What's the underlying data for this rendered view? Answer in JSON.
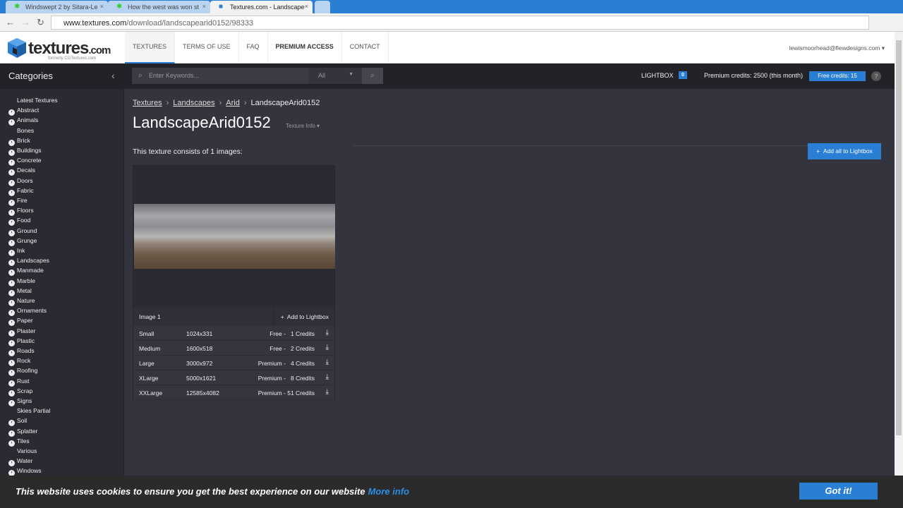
{
  "browser": {
    "tabs": [
      {
        "label": "Windswept 2 by Sitara-Le"
      },
      {
        "label": "How the west was won st"
      },
      {
        "label": "Textures.com - Landscape"
      }
    ],
    "url_domain": "www.textures.com",
    "url_path": "/download/landscapearid0152/98333"
  },
  "header": {
    "logo": "textures",
    "logo_suffix": ".com",
    "logo_sub": "formerly CGTextures.com",
    "menu": [
      "TEXTURES",
      "TERMS OF USE",
      "FAQ",
      "PREMIUM ACCESS",
      "CONTACT"
    ],
    "user": "lewismoorhead@flewdesigns.com"
  },
  "toolbar": {
    "categories_title": "Categories",
    "search_placeholder": "Enter Keywords...",
    "search_scope": "All",
    "lightbox_label": "LIGHTBOX",
    "lightbox_count": "0",
    "premium_credits": "Premium credits: 2500 (this month)",
    "free_credits": "Free credits: 15",
    "help": "?"
  },
  "sidebar": {
    "items": [
      {
        "label": "Latest Textures",
        "expandable": false
      },
      {
        "label": "Abstract",
        "expandable": true
      },
      {
        "label": "Animals",
        "expandable": true
      },
      {
        "label": "Bones",
        "expandable": false
      },
      {
        "label": "Brick",
        "expandable": true
      },
      {
        "label": "Buildings",
        "expandable": true
      },
      {
        "label": "Concrete",
        "expandable": true
      },
      {
        "label": "Decals",
        "expandable": true
      },
      {
        "label": "Doors",
        "expandable": true
      },
      {
        "label": "Fabric",
        "expandable": true
      },
      {
        "label": "Fire",
        "expandable": true
      },
      {
        "label": "Floors",
        "expandable": true
      },
      {
        "label": "Food",
        "expandable": true
      },
      {
        "label": "Ground",
        "expandable": true
      },
      {
        "label": "Grunge",
        "expandable": true
      },
      {
        "label": "Ink",
        "expandable": true
      },
      {
        "label": "Landscapes",
        "expandable": true
      },
      {
        "label": "Manmade",
        "expandable": true
      },
      {
        "label": "Marble",
        "expandable": true
      },
      {
        "label": "Metal",
        "expandable": true
      },
      {
        "label": "Nature",
        "expandable": true
      },
      {
        "label": "Ornaments",
        "expandable": true
      },
      {
        "label": "Paper",
        "expandable": true
      },
      {
        "label": "Plaster",
        "expandable": true
      },
      {
        "label": "Plastic",
        "expandable": true
      },
      {
        "label": "Roads",
        "expandable": true
      },
      {
        "label": "Rock",
        "expandable": true
      },
      {
        "label": "Roofing",
        "expandable": true
      },
      {
        "label": "Rust",
        "expandable": true
      },
      {
        "label": "Scrap",
        "expandable": true
      },
      {
        "label": "Signs",
        "expandable": true
      },
      {
        "label": "Skies Partial",
        "expandable": false
      },
      {
        "label": "Soil",
        "expandable": true
      },
      {
        "label": "Splatter",
        "expandable": true
      },
      {
        "label": "Tiles",
        "expandable": true
      },
      {
        "label": "Various",
        "expandable": false
      },
      {
        "label": "Water",
        "expandable": true
      },
      {
        "label": "Windows",
        "expandable": true
      }
    ]
  },
  "main": {
    "breadcrumb": [
      "Textures",
      "Landscapes",
      "Arid",
      "LandscapeArid0152"
    ],
    "title": "LandscapeArid0152",
    "texture_info": "Texture Info ▾",
    "consists": "This texture consists of 1 images:",
    "add_all": "Add all to Lightbox",
    "image_label": "Image 1",
    "add_to_lightbox": "Add to Lightbox",
    "sizes": [
      {
        "size": "Small",
        "dim": "1024x331",
        "credits": "Free -   1 Credits"
      },
      {
        "size": "Medium",
        "dim": "1600x518",
        "credits": "Free -   2 Credits"
      },
      {
        "size": "Large",
        "dim": "3000x972",
        "credits": "Premium -   4 Credits"
      },
      {
        "size": "XLarge",
        "dim": "5000x1621",
        "credits": "Premium -   8 Credits"
      },
      {
        "size": "XXLarge",
        "dim": "12585x4082",
        "credits": "Premium - 51 Credits"
      }
    ]
  },
  "cookie": {
    "message": "This website uses cookies to ensure you get the best experience on our website",
    "more": "More info",
    "button": "Got it!"
  }
}
